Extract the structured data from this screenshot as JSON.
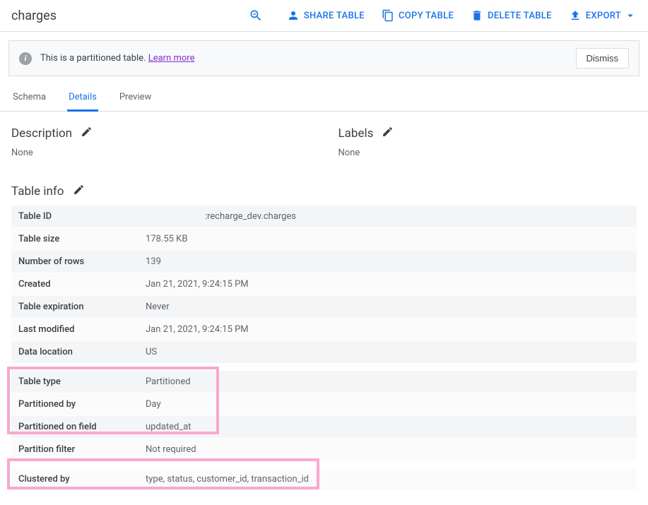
{
  "header": {
    "title": "charges",
    "actions": {
      "share": "SHARE TABLE",
      "copy": "COPY TABLE",
      "delete": "DELETE TABLE",
      "export": "EXPORT"
    }
  },
  "notice": {
    "text": "This is a partitioned table. ",
    "learn": "Learn more",
    "dismiss": "Dismiss"
  },
  "tabs": {
    "schema": "Schema",
    "details": "Details",
    "preview": "Preview"
  },
  "description": {
    "header": "Description",
    "value": "None"
  },
  "labels": {
    "header": "Labels",
    "value": "None"
  },
  "tableinfo": {
    "header": "Table info",
    "rows": {
      "tableId": {
        "label": "Table ID",
        "value": ":recharge_dev.charges"
      },
      "tableSize": {
        "label": "Table size",
        "value": "178.55 KB"
      },
      "numRows": {
        "label": "Number of rows",
        "value": "139"
      },
      "created": {
        "label": "Created",
        "value": "Jan 21, 2021, 9:24:15 PM"
      },
      "expiration": {
        "label": "Table expiration",
        "value": "Never"
      },
      "lastModified": {
        "label": "Last modified",
        "value": "Jan 21, 2021, 9:24:15 PM"
      },
      "dataLocation": {
        "label": "Data location",
        "value": "US"
      },
      "tableType": {
        "label": "Table type",
        "value": "Partitioned"
      },
      "partitionedBy": {
        "label": "Partitioned by",
        "value": "Day"
      },
      "partitionedField": {
        "label": "Partitioned on field",
        "value": "updated_at"
      },
      "partitionFilter": {
        "label": "Partition filter",
        "value": "Not required"
      },
      "clusteredBy": {
        "label": "Clustered by",
        "value": "type, status, customer_id, transaction_id"
      }
    }
  }
}
